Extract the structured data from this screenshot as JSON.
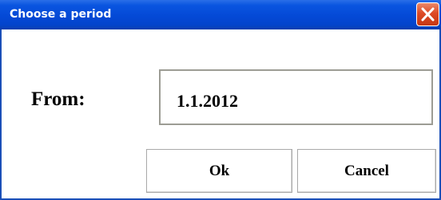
{
  "dialog": {
    "title": "Choose a period",
    "close_icon": "close-icon",
    "from_label": "From:",
    "from_value": "1.1.2012",
    "ok_label": "Ok",
    "cancel_label": "Cancel"
  },
  "colors": {
    "titlebar": "#0449d6",
    "close_button": "#dd4a26",
    "field_border": "#9c9c94"
  }
}
